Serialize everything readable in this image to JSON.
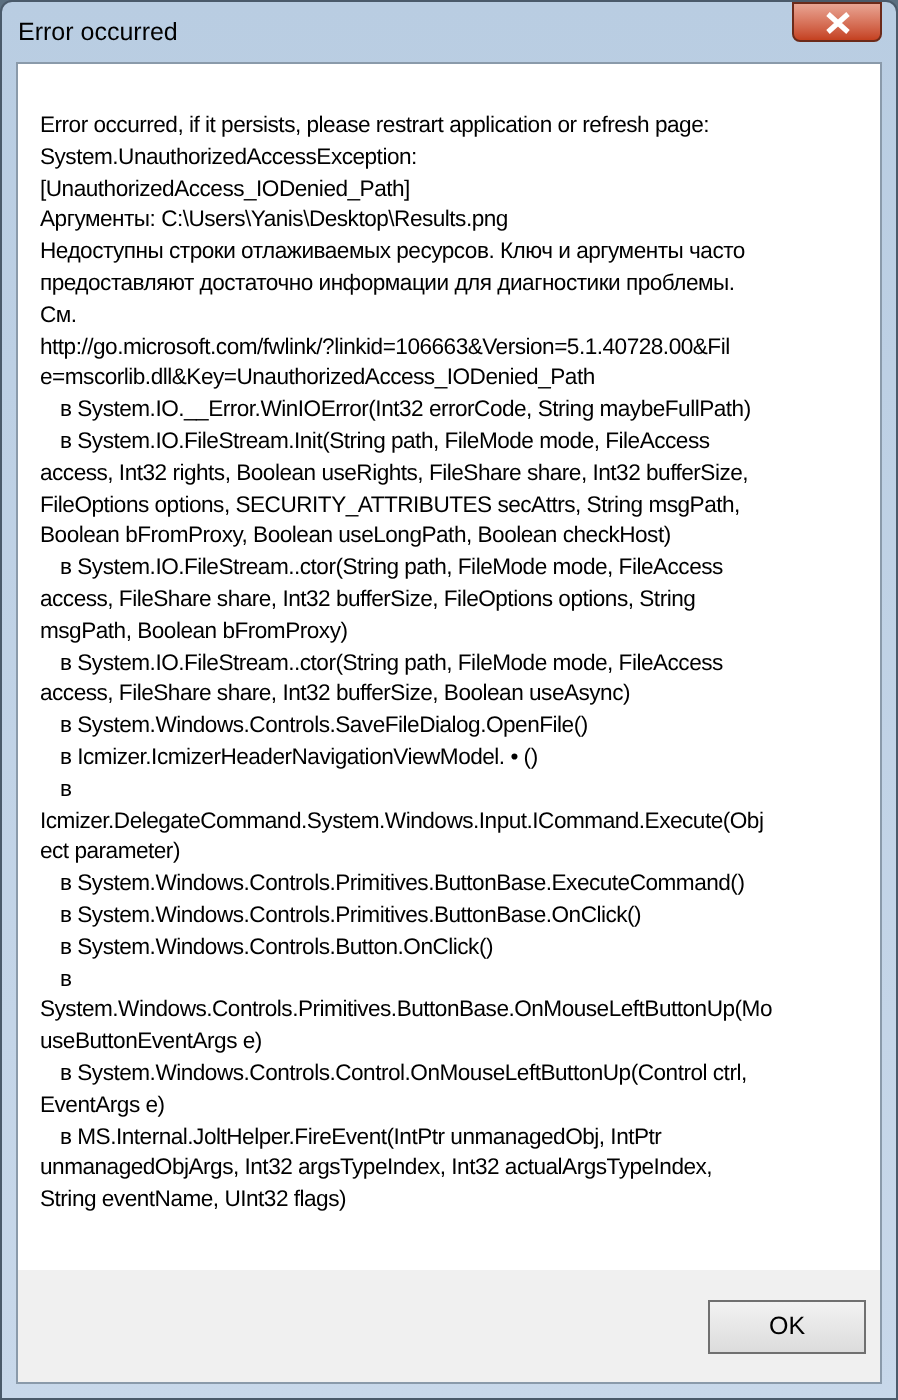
{
  "window": {
    "title": "Error occurred"
  },
  "message_lines": [
    {
      "text": "Error occurred, if it persists, please restrart application or refresh page:",
      "indented": false
    },
    {
      "text": "System.UnauthorizedAccessException:",
      "indented": false
    },
    {
      "text": "[UnauthorizedAccess_IODenied_Path]",
      "indented": false
    },
    {
      "text": "Аргументы: C:\\Users\\Yanis\\Desktop\\Results.png",
      "indented": false
    },
    {
      "text": "Недоступны строки отлаживаемых ресурсов. Ключ и аргументы часто",
      "indented": false
    },
    {
      "text": "предоставляют достаточно информации для диагностики проблемы.",
      "indented": false
    },
    {
      "text": "См.",
      "indented": false
    },
    {
      "text": "http://go.microsoft.com/fwlink/?linkid=106663&Version=5.1.40728.00&Fil",
      "indented": false
    },
    {
      "text": "e=mscorlib.dll&Key=UnauthorizedAccess_IODenied_Path",
      "indented": false
    },
    {
      "text": "в System.IO.__Error.WinIOError(Int32 errorCode, String maybeFullPath)",
      "indented": true
    },
    {
      "text": "в System.IO.FileStream.Init(String path, FileMode mode, FileAccess",
      "indented": true
    },
    {
      "text": "access, Int32 rights, Boolean useRights, FileShare share, Int32 bufferSize,",
      "indented": false
    },
    {
      "text": "FileOptions options, SECURITY_ATTRIBUTES secAttrs, String msgPath,",
      "indented": false
    },
    {
      "text": "Boolean bFromProxy, Boolean useLongPath, Boolean checkHost)",
      "indented": false
    },
    {
      "text": "в System.IO.FileStream..ctor(String path, FileMode mode, FileAccess",
      "indented": true
    },
    {
      "text": "access, FileShare share, Int32 bufferSize, FileOptions options, String",
      "indented": false
    },
    {
      "text": "msgPath, Boolean bFromProxy)",
      "indented": false
    },
    {
      "text": "в System.IO.FileStream..ctor(String path, FileMode mode, FileAccess",
      "indented": true
    },
    {
      "text": "access, FileShare share, Int32 bufferSize, Boolean useAsync)",
      "indented": false
    },
    {
      "text": "в System.Windows.Controls.SaveFileDialog.OpenFile()",
      "indented": true
    },
    {
      "text": "в Icmizer.IcmizerHeaderNavigationViewModel. • ()",
      "indented": true
    },
    {
      "text": "в",
      "indented": true
    },
    {
      "text": "Icmizer.DelegateCommand.System.Windows.Input.ICommand.Execute(Obj",
      "indented": false
    },
    {
      "text": "ect parameter)",
      "indented": false
    },
    {
      "text": "в System.Windows.Controls.Primitives.ButtonBase.ExecuteCommand()",
      "indented": true
    },
    {
      "text": "в System.Windows.Controls.Primitives.ButtonBase.OnClick()",
      "indented": true
    },
    {
      "text": "в System.Windows.Controls.Button.OnClick()",
      "indented": true
    },
    {
      "text": "в",
      "indented": true
    },
    {
      "text": "System.Windows.Controls.Primitives.ButtonBase.OnMouseLeftButtonUp(Mo",
      "indented": false
    },
    {
      "text": "useButtonEventArgs e)",
      "indented": false
    },
    {
      "text": "в System.Windows.Controls.Control.OnMouseLeftButtonUp(Control ctrl,",
      "indented": true
    },
    {
      "text": "EventArgs e)",
      "indented": false
    },
    {
      "text": "в MS.Internal.JoltHelper.FireEvent(IntPtr unmanagedObj, IntPtr",
      "indented": true
    },
    {
      "text": "unmanagedObjArgs, Int32 argsTypeIndex, Int32 actualArgsTypeIndex,",
      "indented": false
    },
    {
      "text": "String eventName, UInt32 flags)",
      "indented": false
    }
  ],
  "buttons": [
    "OK"
  ]
}
